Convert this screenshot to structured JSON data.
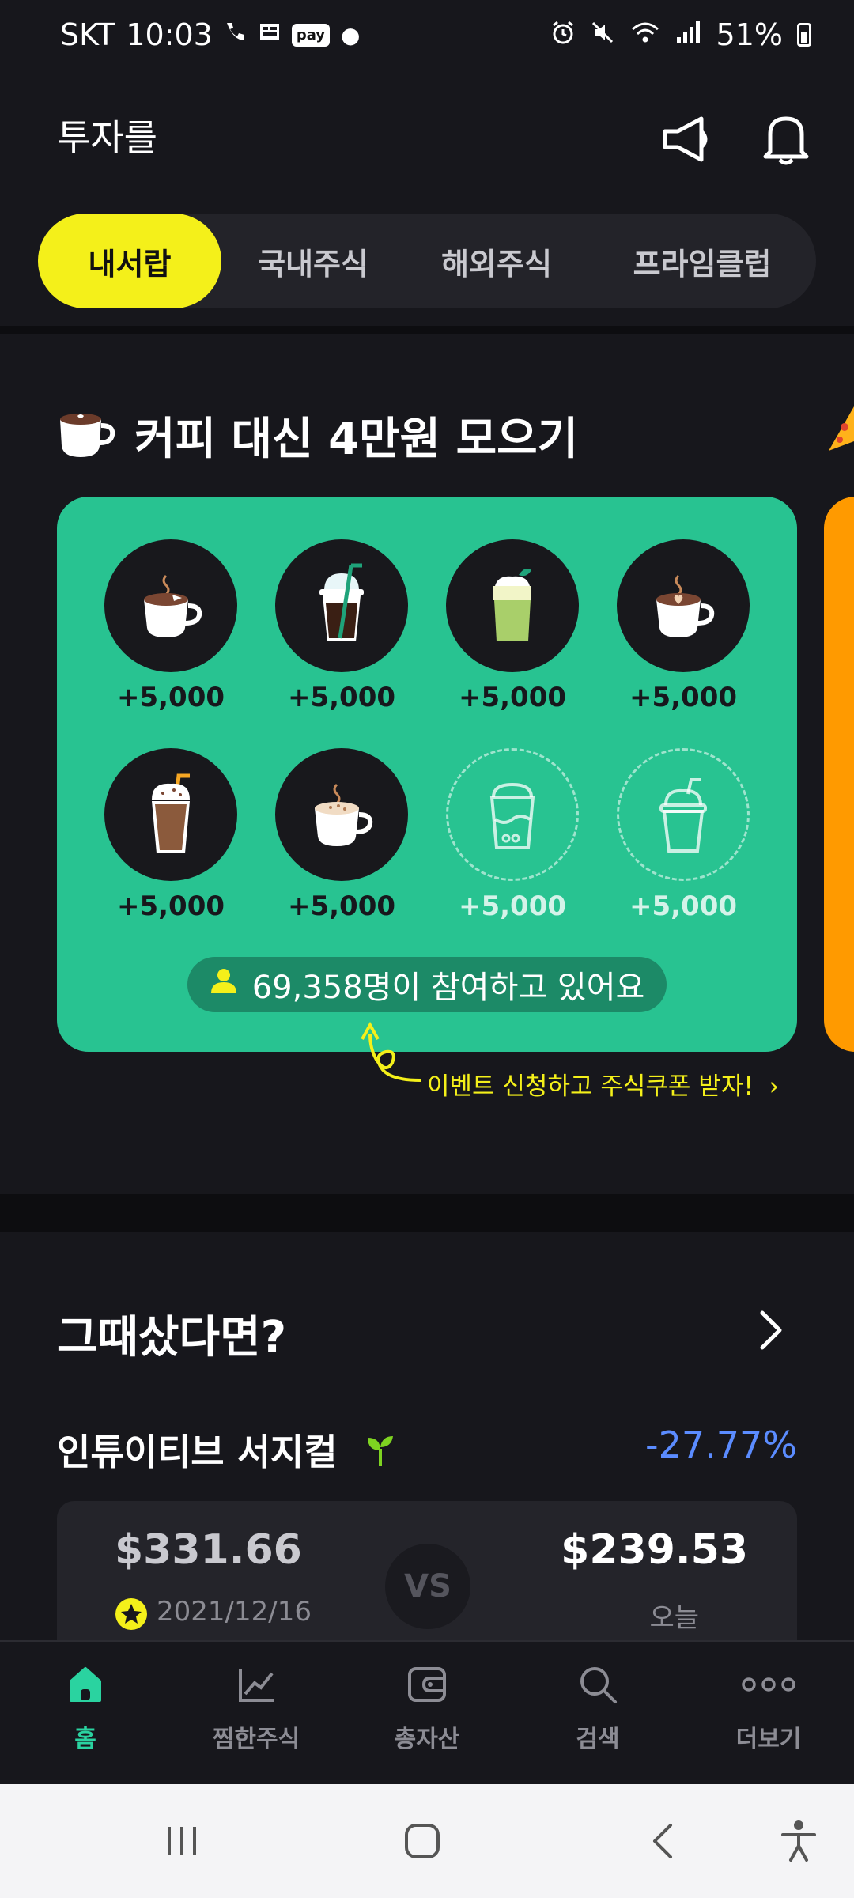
{
  "status_bar": {
    "carrier": "SKT",
    "time": "10:03",
    "pay_badge": "pay",
    "battery": "51%"
  },
  "header": {
    "title": "투자를"
  },
  "tabs": [
    {
      "label": "내서랍",
      "active": true
    },
    {
      "label": "국내주식",
      "active": false
    },
    {
      "label": "해외주식",
      "active": false
    },
    {
      "label": "프라임클럽",
      "active": false
    }
  ],
  "coffee_challenge": {
    "title": "커피 대신 4만원 모으기",
    "cups": [
      {
        "icon": "latte-cup-icon",
        "amount": "+5,000",
        "filled": true
      },
      {
        "icon": "iced-coffee-icon",
        "amount": "+5,000",
        "filled": true
      },
      {
        "icon": "matcha-latte-icon",
        "amount": "+5,000",
        "filled": true
      },
      {
        "icon": "heart-latte-icon",
        "amount": "+5,000",
        "filled": true
      },
      {
        "icon": "iced-mocha-icon",
        "amount": "+5,000",
        "filled": true
      },
      {
        "icon": "cappuccino-icon",
        "amount": "+5,000",
        "filled": true
      },
      {
        "icon": "bubble-tea-icon",
        "amount": "+5,000",
        "filled": false
      },
      {
        "icon": "frappe-icon",
        "amount": "+5,000",
        "filled": false
      }
    ],
    "participants": "69,358명이 참여하고 있어요",
    "event_link": "이벤트 신청하고 주식쿠폰 받자!"
  },
  "if_bought": {
    "title": "그때샀다면?",
    "stock_name": "인튜이티브 서지컬",
    "change": "-27.77%",
    "old_price": "$331.66",
    "old_date": "2021/12/16",
    "vs_label": "VS",
    "current_price": "$239.53",
    "current_label": "오늘"
  },
  "bottom_nav": [
    {
      "label": "홈",
      "icon": "home-icon",
      "active": true
    },
    {
      "label": "찜한주식",
      "icon": "chart-icon",
      "active": false
    },
    {
      "label": "총자산",
      "icon": "wallet-icon",
      "active": false
    },
    {
      "label": "검색",
      "icon": "search-icon",
      "active": false
    },
    {
      "label": "더보기",
      "icon": "more-icon",
      "active": false
    }
  ],
  "colors": {
    "background": "#17171c",
    "accent_yellow": "#f4f01a",
    "card_green": "#28c391",
    "negative_blue": "#5b8cff",
    "nav_active": "#2ad3a0"
  }
}
